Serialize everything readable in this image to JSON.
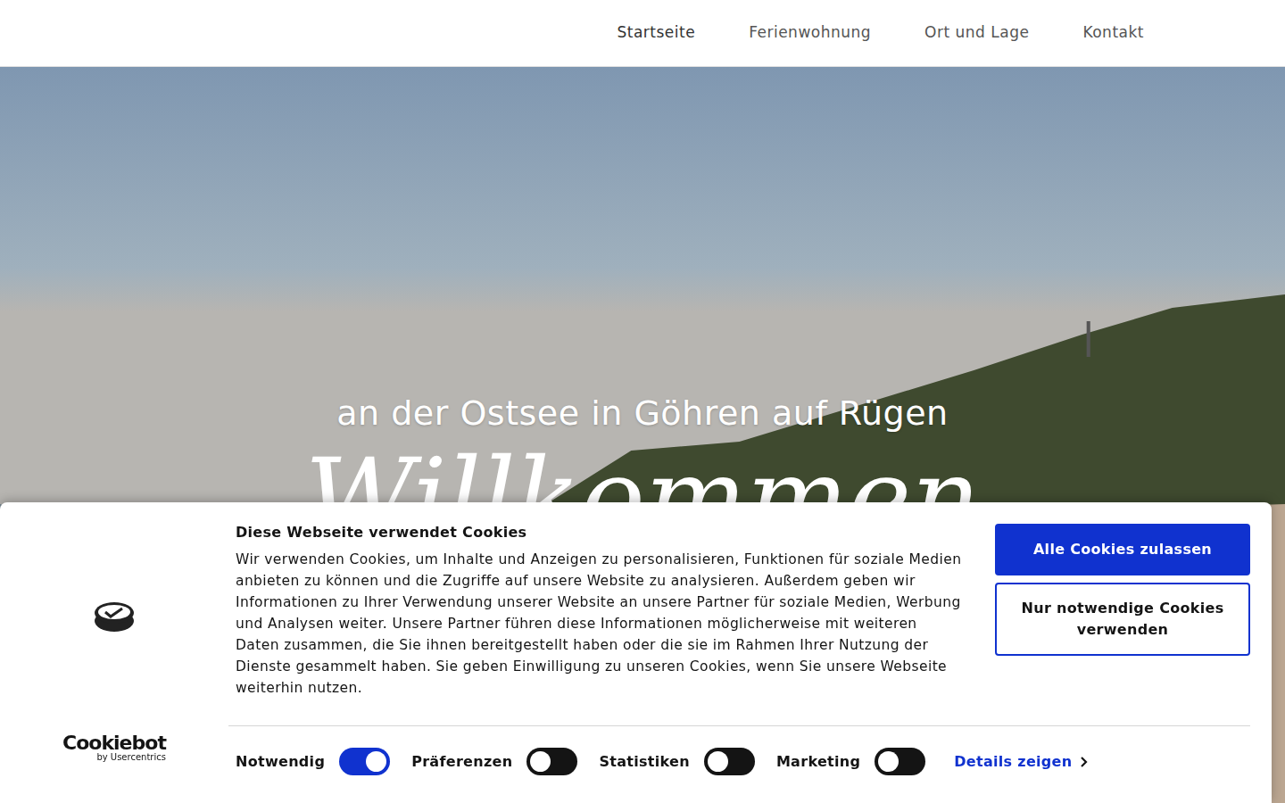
{
  "nav": {
    "items": [
      {
        "label": "Startseite",
        "selected": true
      },
      {
        "label": "Ferienwohnung",
        "selected": false
      },
      {
        "label": "Ort und Lage",
        "selected": false
      },
      {
        "label": "Kontakt",
        "selected": false
      }
    ]
  },
  "hero": {
    "subtitle": "an der Ostsee in Göhren auf Rügen",
    "title": "Willkommen"
  },
  "cookie_banner": {
    "title": "Diese Webseite verwendet Cookies",
    "text": "Wir verwenden Cookies, um Inhalte und Anzeigen zu personalisieren, Funktionen für soziale Medien anbieten zu können und die Zugriffe auf unsere Website zu analysieren. Außerdem geben wir Informationen zu Ihrer Verwendung unserer Website an unsere Partner für soziale Medien, Werbung und Analysen weiter. Unsere Partner führen diese Informationen möglicherweise mit weiteren Daten zusammen, die Sie ihnen bereitgestellt haben oder die sie im Rahmen Ihrer Nutzung der Dienste gesammelt haben. Sie geben Einwilligung zu unseren Cookies, wenn Sie unsere Webseite weiterhin nutzen.",
    "toggles": [
      {
        "label": "Notwendig",
        "on": true
      },
      {
        "label": "Präferenzen",
        "on": false
      },
      {
        "label": "Statistiken",
        "on": false
      },
      {
        "label": "Marketing",
        "on": false
      }
    ],
    "details": "Details zeigen",
    "buttons": [
      "Alle Cookies zulassen",
      "Nur notwendige Cookies verwenden"
    ],
    "brand": "Cookiebot",
    "brand_sub": "by Usercentrics"
  }
}
